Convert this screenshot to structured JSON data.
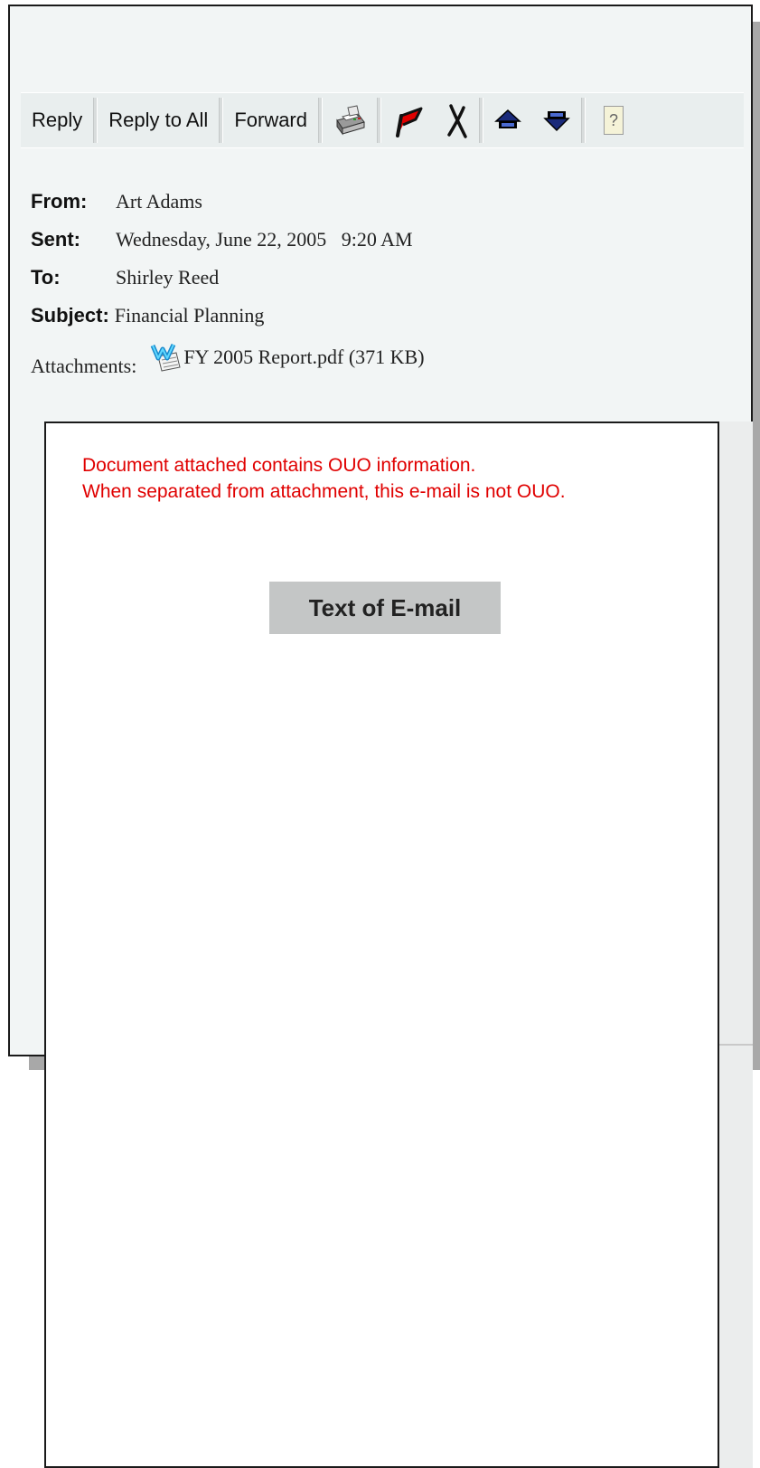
{
  "toolbar": {
    "reply_label": "Reply",
    "reply_all_label": "Reply to All",
    "forward_label": "Forward",
    "help_label": "?",
    "icons": [
      "print-icon",
      "flag-icon",
      "delete-icon",
      "previous-item-icon",
      "next-item-icon",
      "help-icon"
    ]
  },
  "header": {
    "from_label": "From:",
    "from_value": "Art Adams",
    "sent_label": "Sent:",
    "sent_value": "Wednesday, June 22, 2005   9:20 AM",
    "to_label": "To:",
    "to_value": "Shirley Reed",
    "subject_label": "Subject:",
    "subject_value": "Financial Planning",
    "attachments_label": "Attachments:",
    "attachment_name": "FY 2005 Report.pdf (371 KB)"
  },
  "body": {
    "ouo_line1": "Document attached contains OUO information.",
    "ouo_line2": "When separated from attachment, this e-mail is not OUO.",
    "placeholder": "Text of E-mail"
  },
  "colors": {
    "warning_text": "#e00000",
    "window_bg": "#f2f5f5",
    "flag": "#e00000",
    "arrows": "#1a2a7a"
  }
}
